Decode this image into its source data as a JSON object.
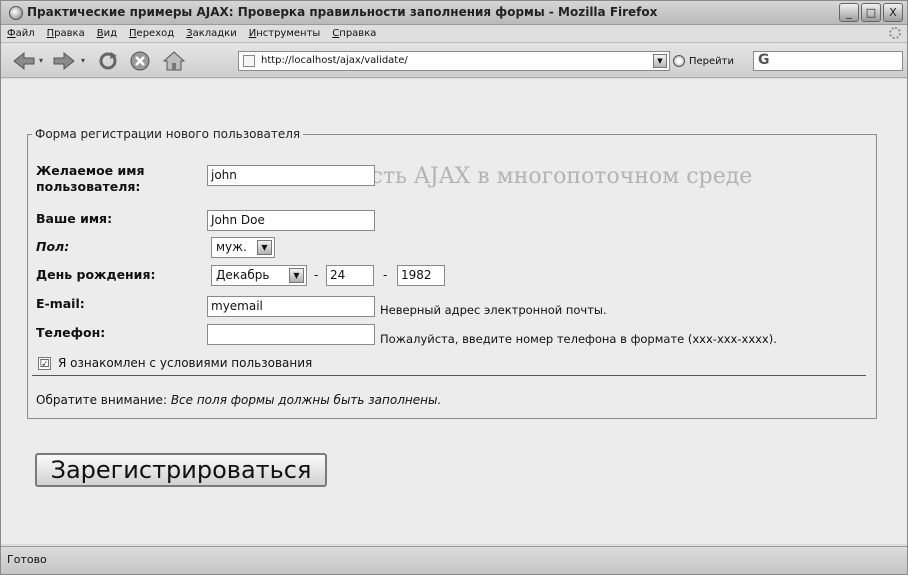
{
  "window": {
    "title": "Практические примеры AJAX: Проверка правильности заполнения формы - Mozilla Firefox",
    "controls": [
      "_",
      "□",
      "X"
    ]
  },
  "menu": [
    {
      "label": "Файл",
      "accel": "Ф",
      "rest": "айл"
    },
    {
      "label": "Правка",
      "accel": "П",
      "rest": "равка"
    },
    {
      "label": "Вид",
      "accel": "В",
      "rest": "ид"
    },
    {
      "label": "Переход",
      "accel": "П",
      "rest": "ереход"
    },
    {
      "label": "Закладки",
      "accel": "З",
      "rest": "акладки"
    },
    {
      "label": "Инструменты",
      "accel": "И",
      "rest": "нструменты"
    },
    {
      "label": "Справка",
      "accel": "С",
      "rest": "правка"
    }
  ],
  "toolbar": {
    "url": "http://localhost/ajax/validate/",
    "go_label": "Перейти",
    "search_icon": "G"
  },
  "form": {
    "legend": "Форма регистрации нового пользователя",
    "username_label_1": "Желаемое имя",
    "username_label_2": "пользователя:",
    "username_value": "john",
    "name_label": "Ваше имя:",
    "name_value": "John Doe",
    "gender_label": "Пол:",
    "gender_value": "муж.",
    "birthday_label": "День рождения:",
    "birth_month": "Декабрь",
    "birth_day": "24",
    "birth_year": "1982",
    "dash": "-",
    "email_label": "E-mail:",
    "email_value": "myemail",
    "email_error": "Неверный адрес электронной почты.",
    "phone_label": "Телефон:",
    "phone_value": "",
    "phone_error": "Пожалуйста, введите номер телефона в формате (xxx-xxx-xxxx).",
    "terms_label": "Я ознакомлен с условиями пользования",
    "terms_checked": "☑",
    "note_prefix": "Обратите внимание: ",
    "note_italic": "Все поля формы должны быть заполнены.",
    "submit_label": "Зарегистрироваться"
  },
  "background_text": {
    "heading": "безопасность AJAX в многопоточном среде"
  },
  "status": {
    "text": "Готово"
  }
}
